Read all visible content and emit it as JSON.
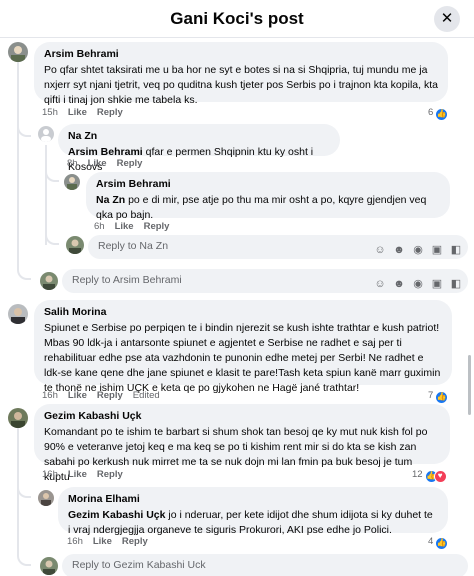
{
  "header": {
    "title": "Gani Koci's post",
    "close_icon": "close-icon"
  },
  "comments": [
    {
      "author": "Arsim Behrami",
      "text": "Po qfar shtet taksirati me u ba hor ne syt e botes si na si Shqipria, tuj mundu me ja nxjerr syt njani tjetrit, veq po quditna kush tjeter pos Serbis po i trajnon kta kopila, kta qifti i tinaj jon shkie me tabela ks.",
      "time": "15h",
      "like": "Like",
      "reply": "Reply",
      "reactions": "6"
    },
    {
      "author": "Na Zn",
      "mention": "Arsim Behrami",
      "text": " qfar e permen Shqipnin ktu ky osht i Kosovs",
      "time": "8h",
      "like": "Like",
      "reply": "Reply"
    },
    {
      "author": "Arsim Behrami",
      "mention": "Na Zn",
      "text": " po e di mir, pse atje po thu ma mir osht a po, kqyre gjendjen veq qka po bajn.",
      "time": "6h",
      "like": "Like",
      "reply": "Reply"
    },
    {
      "author": "Salih Morina",
      "text": "Spiunet e Serbise po perpiqen te i bindin njerezit se kush ishte trathtar e kush patriot! Mbas 90 ldk-ja i antarsonte spiunet e agjentet e Serbise ne radhet e saj per ti rehabilituar edhe pse ata vazhdonin te punonin edhe metej per Serbi! Ne radhet e ldk-se kane qene dhe jane spiunet e klasit te pare!Tash keta spiun kanë marr guximin te thonë ne ishim UÇK e keta qe po gjykohen ne Hagë jané trathtar!",
      "time": "16h",
      "like": "Like",
      "reply": "Reply",
      "edited": "Edited",
      "reactions": "7"
    },
    {
      "author": "Gezim Kabashi Uçk",
      "text": "Komandant po te ishim te barbart si shum shok tan besoj qe ky mut nuk kish fol po 90% e veteranve jetoj keq e ma keq se po ti kishim rent mir si do kta se kish zan sabahi po kerkush nuk mirret me ta se nuk dojn mi lan fmin pa buk besoj je tum kuptu",
      "time": "16h",
      "like": "Like",
      "reply": "Reply",
      "reactions": "12"
    },
    {
      "author": "Morina Elhami",
      "mention": "Gezim Kabashi Uçk",
      "text": " jo i nderuar, per kete idijot dhe shum idijota si ky duhet te i vraj ndergjegjja organeve te siguris Prokurori, AKI pse edhe jo Polici.",
      "time": "16h",
      "like": "Like",
      "reply": "Reply",
      "reactions": "4"
    }
  ],
  "reply_boxes": {
    "na_zn": "Reply to Na Zn",
    "arsim": "Reply to Arsim Behrami",
    "gezim": "Reply to Gezim Kabashi Uck"
  },
  "colors": {
    "like": "#1877f2",
    "love": "#f33e58",
    "bubble": "#f0f2f5",
    "muted": "#65676b"
  }
}
